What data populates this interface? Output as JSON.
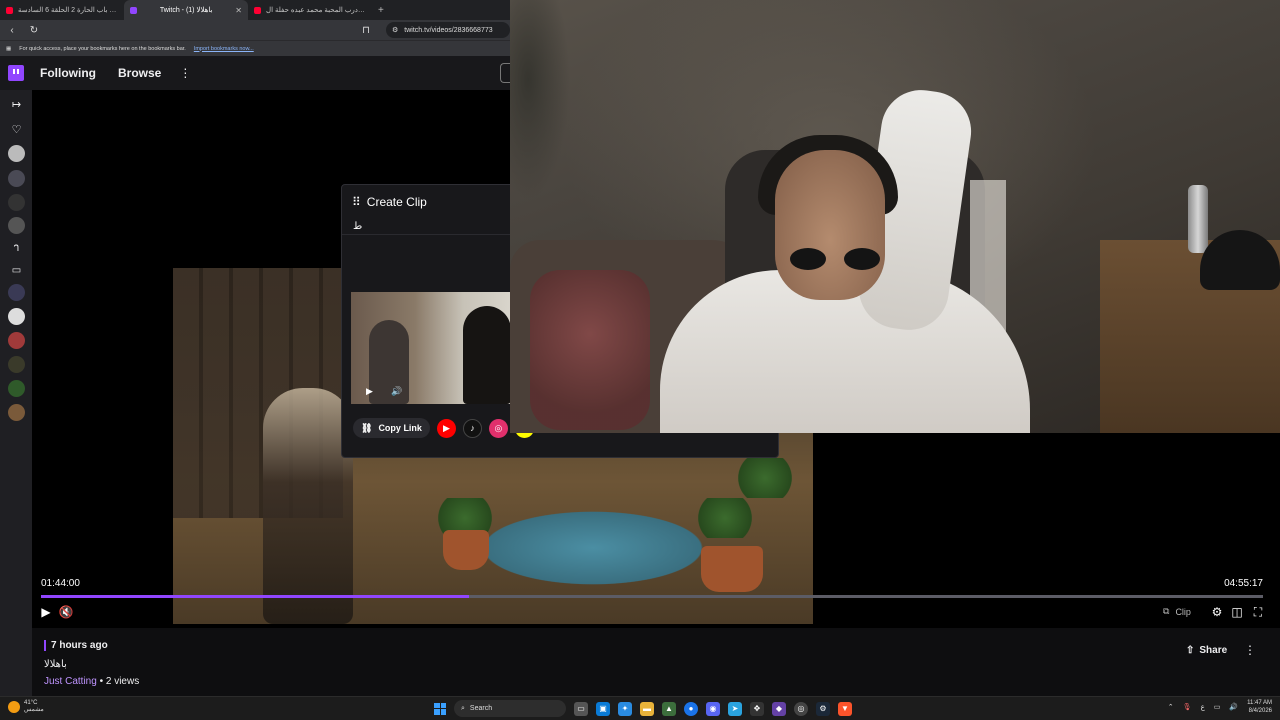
{
  "browser": {
    "tabs": [
      {
        "title": "مسلسل باب الحارة 2 الحلقة 6 السادسة",
        "favicon_color": "#ff0033",
        "active": false
      },
      {
        "title": "Twitch - (1) باهلالا",
        "favicon_color": "#9146ff",
        "active": true
      },
      {
        "title": "ويناك ي درب المحبة محمد عبده حفلة ال",
        "favicon_color": "#ff0033",
        "active": false
      }
    ],
    "close_glyph": "✕",
    "new_tab_glyph": "+",
    "url": "twitch.tv/videos/2836668773",
    "bookmarks_text": "For quick access, place your bookmarks here on the bookmarks bar.",
    "bookmarks_link": "Import bookmarks now..."
  },
  "twitch_nav": {
    "following": "Following",
    "browse": "Browse",
    "more_glyph": "⋮"
  },
  "player": {
    "current_time": "01:44:00",
    "total_time": "04:55:17",
    "progress": 0.35,
    "clip_label": "Clip"
  },
  "clip_popup": {
    "title": "Create Clip",
    "arabic_label": "ط",
    "copy_link": "Copy Link",
    "socials": [
      {
        "name": "youtube-icon",
        "color": "#ff0000",
        "glyph": "▶"
      },
      {
        "name": "tiktok-icon",
        "color": "#111111",
        "glyph": "♪"
      },
      {
        "name": "instagram-icon",
        "color": "#e1306c",
        "glyph": "◎"
      },
      {
        "name": "snapchat-icon",
        "color": "#fffc00",
        "glyph": ""
      }
    ]
  },
  "video_info": {
    "ago": "7 hours ago",
    "title": "باهلالا",
    "category": "Just Catting",
    "views": " • 2 views",
    "share": "Share",
    "more_glyph": "⋮"
  },
  "taskbar": {
    "temp": "41°C",
    "weather_text": "مشمس",
    "search": "Search",
    "lang": "ع",
    "time": "11:47 AM",
    "date": "8/4/2026"
  },
  "colors": {
    "accent": "#9146ff",
    "link": "#bf94ff"
  }
}
